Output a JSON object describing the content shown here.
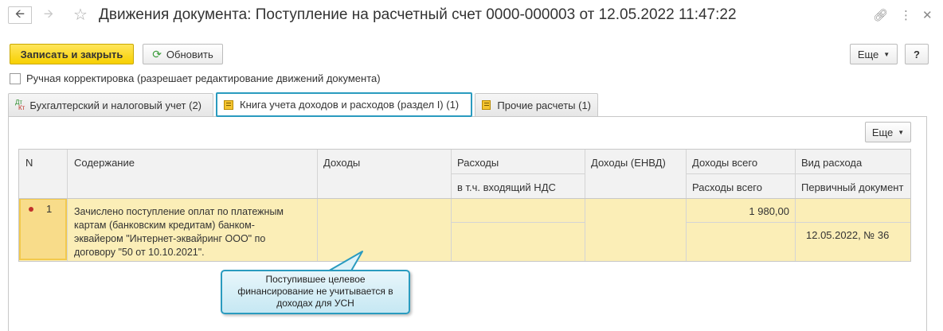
{
  "window": {
    "title": "Движения документа: Поступление на расчетный счет 0000-000003 от 12.05.2022 11:47:22"
  },
  "toolbar": {
    "save_close": "Записать и закрыть",
    "refresh": "Обновить",
    "more": "Еще",
    "help": "?"
  },
  "manual_edit": {
    "label": "Ручная корректировка (разрешает редактирование движений документа)",
    "checked": false
  },
  "tabs": [
    {
      "label": "Бухгалтерский и налоговый учет (2)",
      "icon": "dt-kt-icon"
    },
    {
      "label": "Книга учета доходов и расходов (раздел I) (1)",
      "icon": "book-icon",
      "active": true
    },
    {
      "label": "Прочие расчеты (1)",
      "icon": "book-icon"
    }
  ],
  "panel": {
    "more": "Еще"
  },
  "table": {
    "columns": {
      "n": "N",
      "content": "Содержание",
      "income": "Доходы",
      "expenses": "Расходы",
      "expenses_vat": "в т.ч. входящий НДС",
      "income_envd": "Доходы (ЕНВД)",
      "income_total": "Доходы всего",
      "expenses_total": "Расходы всего",
      "expense_type": "Вид расхода",
      "primary_doc": "Первичный документ"
    },
    "rows": [
      {
        "n": "1",
        "content_lines": [
          "Зачислено поступление оплат по платежным",
          "картам (банковским кредитам) банком-",
          "эквайером \"Интернет-эквайринг ООО\" по",
          "договору \"50 от 10.10.2021\"."
        ],
        "income_total": "1 980,00",
        "primary_doc": "12.05.2022, № 36"
      }
    ]
  },
  "callout": {
    "lines": [
      "Поступившее целевое",
      "финансирование не учитывается в",
      "доходах для УСН"
    ]
  },
  "colors": {
    "accent": "#2a9bbf",
    "primary_button": "#f7d000",
    "row_highlight": "#fbeeb7"
  }
}
